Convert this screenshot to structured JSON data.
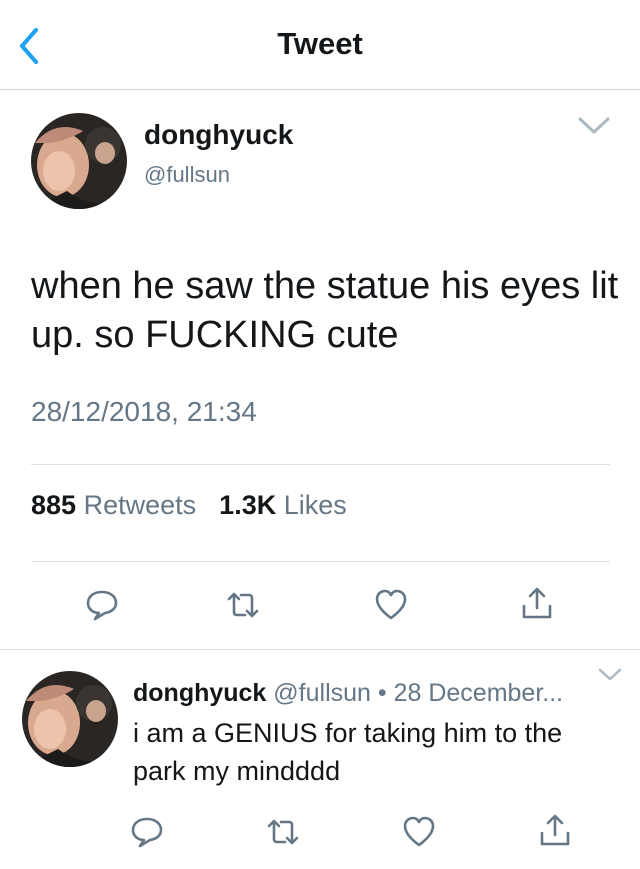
{
  "nav": {
    "title": "Tweet"
  },
  "tweet": {
    "display_name": "donghyuck",
    "handle": "@fullsun",
    "text": "when he saw the statue his eyes lit up. so FUCKING cute",
    "timestamp": "28/12/2018, 21:34",
    "retweets_count": "885",
    "retweets_label": "Retweets",
    "likes_count": "1.3K",
    "likes_label": "Likes"
  },
  "reply": {
    "display_name": "donghyuck",
    "meta": "@fullsun • 28 December...",
    "text": "i am a GENIUS for taking him to the park my mindddd"
  },
  "icons": {
    "back": "chevron-left-icon",
    "more": "chevron-down-icon",
    "reply": "comment-bubble-icon",
    "retweet": "retweet-icon",
    "like": "heart-icon",
    "share": "share-icon"
  },
  "colors": {
    "accent": "#1da1f2",
    "secondary_text": "#657786",
    "primary_text": "#14171a"
  }
}
